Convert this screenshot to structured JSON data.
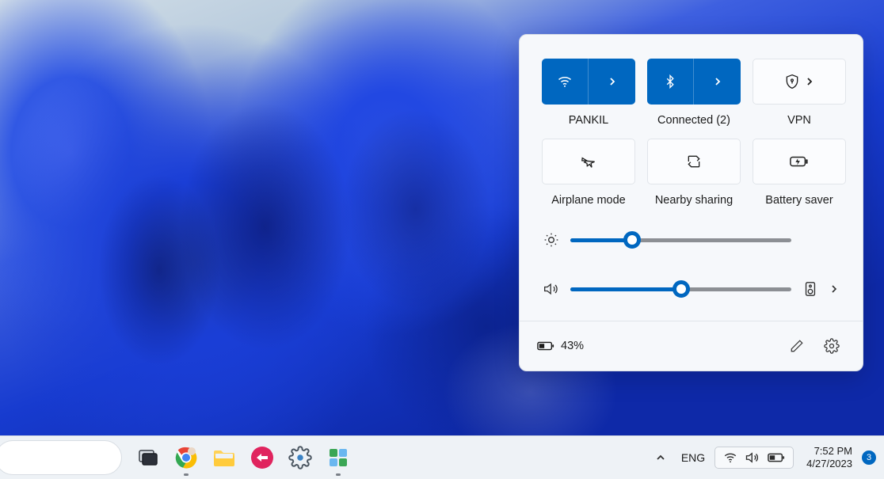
{
  "quick_settings": {
    "tiles": [
      {
        "id": "wifi",
        "label": "PANKIL",
        "active": true,
        "split": true,
        "icon": "wifi-icon"
      },
      {
        "id": "bluetooth",
        "label": "Connected (2)",
        "active": true,
        "split": true,
        "icon": "bluetooth-icon"
      },
      {
        "id": "vpn",
        "label": "VPN",
        "active": false,
        "split": false,
        "icon": "vpn-icon",
        "chev": true
      },
      {
        "id": "airplane",
        "label": "Airplane mode",
        "active": false,
        "split": false,
        "icon": "airplane-icon"
      },
      {
        "id": "nearby",
        "label": "Nearby sharing",
        "active": false,
        "split": false,
        "icon": "nearby-share-icon"
      },
      {
        "id": "battery",
        "label": "Battery saver",
        "active": false,
        "split": false,
        "icon": "battery-saver-icon"
      }
    ],
    "brightness_pct": 28,
    "volume_pct": 50,
    "battery_text": "43%"
  },
  "taskbar": {
    "language": "ENG",
    "time": "7:52 PM",
    "date": "4/27/2023",
    "notification_count": "3"
  }
}
